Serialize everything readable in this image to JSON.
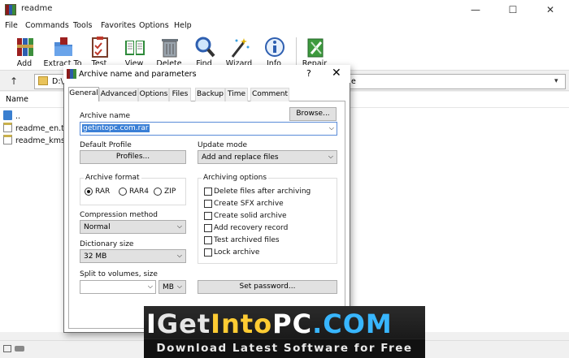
{
  "window": {
    "title": "readme",
    "min": "—",
    "max": "☐",
    "close": "✕"
  },
  "menu": [
    "File",
    "Commands",
    "Tools",
    "Favorites",
    "Options",
    "Help"
  ],
  "toolbar": [
    {
      "label": "Add",
      "icon": "add-archive-icon"
    },
    {
      "label": "Extract To",
      "icon": "extract-folder-icon"
    },
    {
      "label": "Test",
      "icon": "test-clipboard-icon"
    },
    {
      "label": "View",
      "icon": "view-book-icon"
    },
    {
      "label": "Delete",
      "icon": "trash-icon"
    },
    {
      "label": "Find",
      "icon": "magnifier-icon"
    },
    {
      "label": "Wizard",
      "icon": "magic-wand-icon"
    },
    {
      "label": "Info",
      "icon": "info-icon"
    },
    {
      "label": "Repair",
      "icon": "repair-book-icon"
    }
  ],
  "address": {
    "path": "D:\\S",
    "tail": "e",
    "up": "↑"
  },
  "list": {
    "header": "Name",
    "rows": [
      "..",
      "readme_en.txt",
      "readme_kms.t"
    ]
  },
  "dialog": {
    "title": "Archive name and parameters",
    "help": "?",
    "close": "✕",
    "tabs": [
      "General",
      "Advanced",
      "Options",
      "Files",
      "Backup",
      "Time",
      "Comment"
    ],
    "archive_name_label": "Archive name",
    "browse": "Browse...",
    "archive_name": "getintopc.com.rar",
    "default_profile_label": "Default Profile",
    "profiles": "Profiles...",
    "update_mode_label": "Update mode",
    "update_mode": "Add and replace files",
    "archive_format_label": "Archive format",
    "formats": [
      "RAR",
      "RAR4",
      "ZIP"
    ],
    "selected_format": "RAR",
    "archiving_options_label": "Archiving options",
    "options": [
      "Delete files after archiving",
      "Create SFX archive",
      "Create solid archive",
      "Add recovery record",
      "Test archived files",
      "Lock archive"
    ],
    "compression_label": "Compression method",
    "compression": "Normal",
    "dictionary_label": "Dictionary size",
    "dictionary": "32 MB",
    "split_label": "Split to volumes, size",
    "split_value": "",
    "split_unit": "MB",
    "set_password": "Set password..."
  },
  "watermark": {
    "parts": [
      {
        "t": "I",
        "c": "#ffffff"
      },
      {
        "t": "Get",
        "c": "#e6e6e6"
      },
      {
        "t": "Into",
        "c": "#ffcc33"
      },
      {
        "t": "PC",
        "c": "#ffffff"
      },
      {
        "t": ".COM",
        "c": "#38b6ff"
      }
    ],
    "subtitle": "Download Latest Software for Free"
  }
}
